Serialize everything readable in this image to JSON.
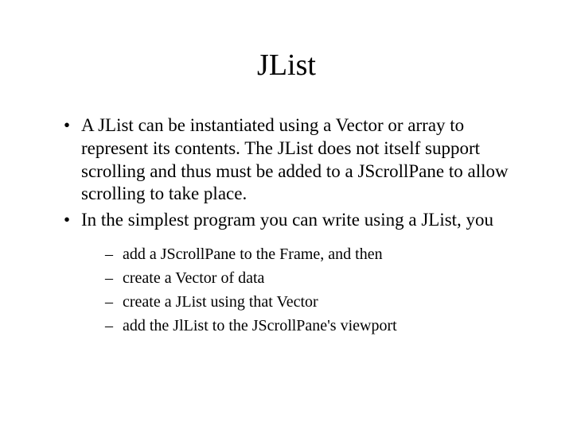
{
  "title": "JList",
  "bullets": [
    "A JList can be instantiated using a Vector or array to represent its contents. The JList does not itself support scrolling and thus must be added to a JScrollPane to allow scrolling to take place.",
    "In the simplest program you can write using a JList, you"
  ],
  "subbullets": [
    "add a JScrollPane to the Frame, and then",
    "create a Vector of data",
    "create a JList using that Vector",
    "add the JlList to the JScrollPane's viewport"
  ]
}
